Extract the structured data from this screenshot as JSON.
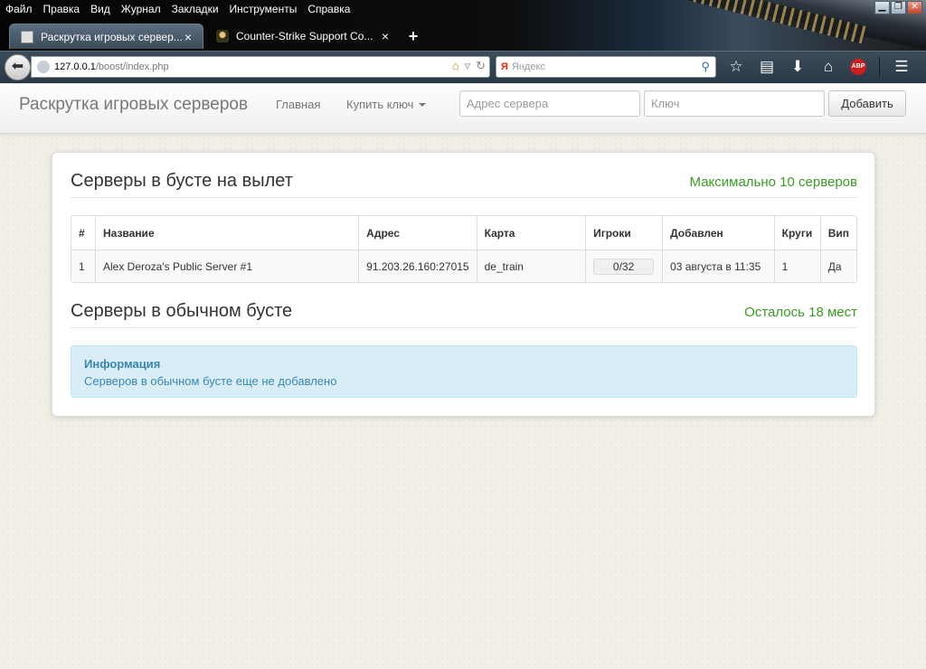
{
  "browser": {
    "menu": [
      "Файл",
      "Правка",
      "Вид",
      "Журнал",
      "Закладки",
      "Инструменты",
      "Справка"
    ],
    "tabs": [
      {
        "label": "Раскрутка игровых сервер...",
        "icon": "counter-strike-icon",
        "active": true
      },
      {
        "label": "Counter-Strike Support Co...",
        "icon": "counter-strike-character-icon",
        "active": false
      }
    ],
    "url_host": "127.0.0.1",
    "url_path": "/boost/index.php",
    "search_placeholder": "Яндекс",
    "window_controls": [
      "minimize",
      "restore",
      "close"
    ],
    "abp_label": "ABP"
  },
  "navbar": {
    "brand": "Раскрутка игровых серверов",
    "home": "Главная",
    "buy_key": "Купить ключ",
    "address_placeholder": "Адрес сервера",
    "key_placeholder": "Ключ",
    "add_button": "Добавить"
  },
  "boost_section": {
    "title": "Серверы в бусте на вылет",
    "note": "Максимально 10 серверов",
    "columns": [
      "#",
      "Название",
      "Адрес",
      "Карта",
      "Игроки",
      "Добавлен",
      "Круги",
      "Вип"
    ],
    "rows": [
      {
        "num": "1",
        "name": "Alex Deroza's Public Server #1",
        "address": "91.203.26.160:27015",
        "map": "de_train",
        "players": "0/32",
        "added": "03 августа в 11:35",
        "rounds": "1",
        "vip": "Да"
      }
    ]
  },
  "regular_section": {
    "title": "Серверы в обычном бусте",
    "note": "Осталось 18 мест",
    "alert_title": "Информация",
    "alert_text": "Серверов в обычном бусте еще не добавлено"
  },
  "colors": {
    "note_green": "#3a9a22",
    "alert_bg": "#d9edf7",
    "alert_text": "#3a87ad"
  }
}
